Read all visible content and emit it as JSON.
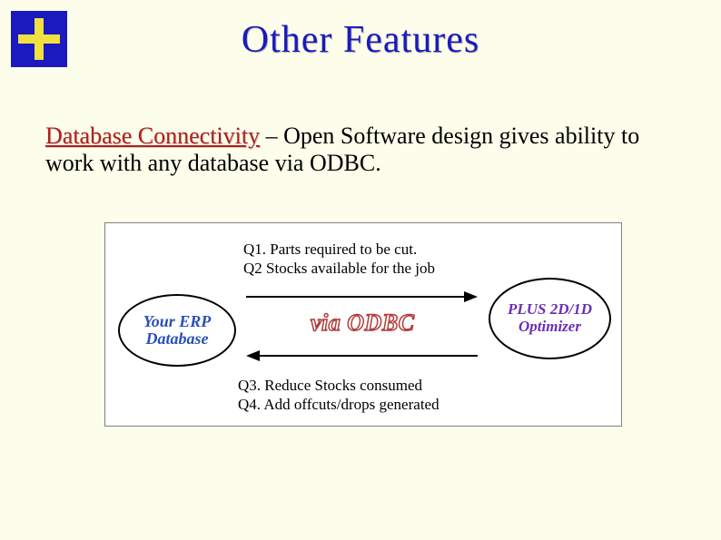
{
  "title": "Other Features",
  "description": {
    "lead": "Database Connectivity",
    "sep": " – ",
    "rest": "Open Software design gives ability to work with any database via ODBC."
  },
  "diagram": {
    "left_ellipse_line1": "Your ERP",
    "left_ellipse_line2": "Database",
    "center_label": "via ODBC",
    "right_ellipse_line1": "PLUS 2D/1D",
    "right_ellipse_line2": "Optimizer",
    "q1": "Q1.   Parts required to be cut.",
    "q2": "Q2   Stocks available for the job",
    "q3": "Q3.   Reduce Stocks consumed",
    "q4": "Q4.  Add offcuts/drops generated"
  }
}
